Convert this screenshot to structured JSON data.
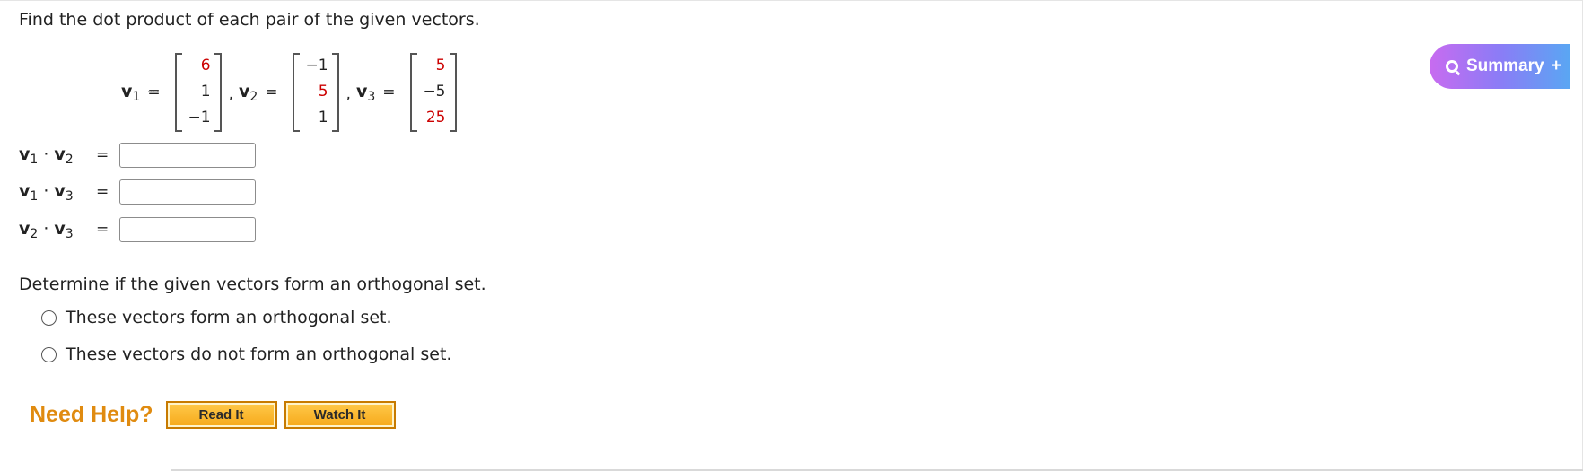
{
  "question": "Find the dot product of each pair of the given vectors.",
  "vectors": [
    {
      "label": "v",
      "sub": "1",
      "entries": [
        "6",
        "1",
        "−1"
      ],
      "entry_colors": [
        "#cc0000",
        "#222222",
        "#222222"
      ]
    },
    {
      "label": "v",
      "sub": "2",
      "entries": [
        "−1",
        "5",
        "1"
      ],
      "entry_colors": [
        "#222222",
        "#cc0000",
        "#222222"
      ]
    },
    {
      "label": "v",
      "sub": "3",
      "entries": [
        "5",
        "−5",
        "25"
      ],
      "entry_colors": [
        "#cc0000",
        "#222222",
        "#cc0000"
      ]
    }
  ],
  "equals": "=",
  "comma": ",",
  "dot": "·",
  "products": [
    {
      "a": "v",
      "a_sub": "1",
      "b": "v",
      "b_sub": "2",
      "value": ""
    },
    {
      "a": "v",
      "a_sub": "1",
      "b": "v",
      "b_sub": "3",
      "value": ""
    },
    {
      "a": "v",
      "a_sub": "2",
      "b": "v",
      "b_sub": "3",
      "value": ""
    }
  ],
  "orthogonal_prompt": "Determine if the given vectors form an orthogonal set.",
  "options": [
    "These vectors form an orthogonal set.",
    "These vectors do not form an orthogonal set."
  ],
  "help": {
    "label": "Need Help?",
    "read_button": "Read It",
    "watch_button": "Watch It"
  },
  "summary_button": {
    "label": "Summary",
    "plus": "+",
    "icon": "search-icon"
  },
  "colors": {
    "entry_red": "#cc0000",
    "help_orange": "#e08b10",
    "button_fill": "#f6a91a",
    "summary_gradient": [
      "#c86bf0",
      "#8b7cf6",
      "#5aa6f3"
    ]
  }
}
